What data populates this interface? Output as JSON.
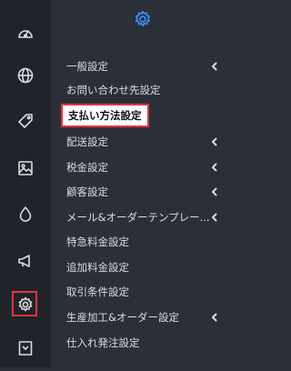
{
  "colors": {
    "rail_bg": "#1f242b",
    "panel_bg": "#2b3038",
    "text": "#d9dce0",
    "accent": "#3c8cff",
    "highlight_border": "#e8323b"
  },
  "rail": {
    "items": [
      {
        "icon": "dashboard-icon"
      },
      {
        "icon": "globe-icon"
      },
      {
        "icon": "tag-icon"
      },
      {
        "icon": "image-icon"
      },
      {
        "icon": "drop-icon"
      },
      {
        "icon": "megaphone-icon"
      },
      {
        "icon": "gear-icon",
        "active": true
      },
      {
        "icon": "inbox-icon"
      }
    ]
  },
  "panel": {
    "header_icon": "gear-icon",
    "items": [
      {
        "label": "一般設定",
        "has_submenu": true
      },
      {
        "label": "お問い合わせ先設定",
        "has_submenu": false
      },
      {
        "label": "支払い方法設定",
        "has_submenu": false,
        "highlighted": true
      },
      {
        "label": "配送設定",
        "has_submenu": true
      },
      {
        "label": "税金設定",
        "has_submenu": true
      },
      {
        "label": "顧客設定",
        "has_submenu": true
      },
      {
        "label": "メール&オーダーテンプレー...",
        "has_submenu": true
      },
      {
        "label": "特急料金設定",
        "has_submenu": false
      },
      {
        "label": "追加料金設定",
        "has_submenu": false
      },
      {
        "label": "取引条件設定",
        "has_submenu": false
      },
      {
        "label": "生産加工&オーダー設定",
        "has_submenu": true
      },
      {
        "label": "仕入れ発注設定",
        "has_submenu": false
      }
    ]
  }
}
